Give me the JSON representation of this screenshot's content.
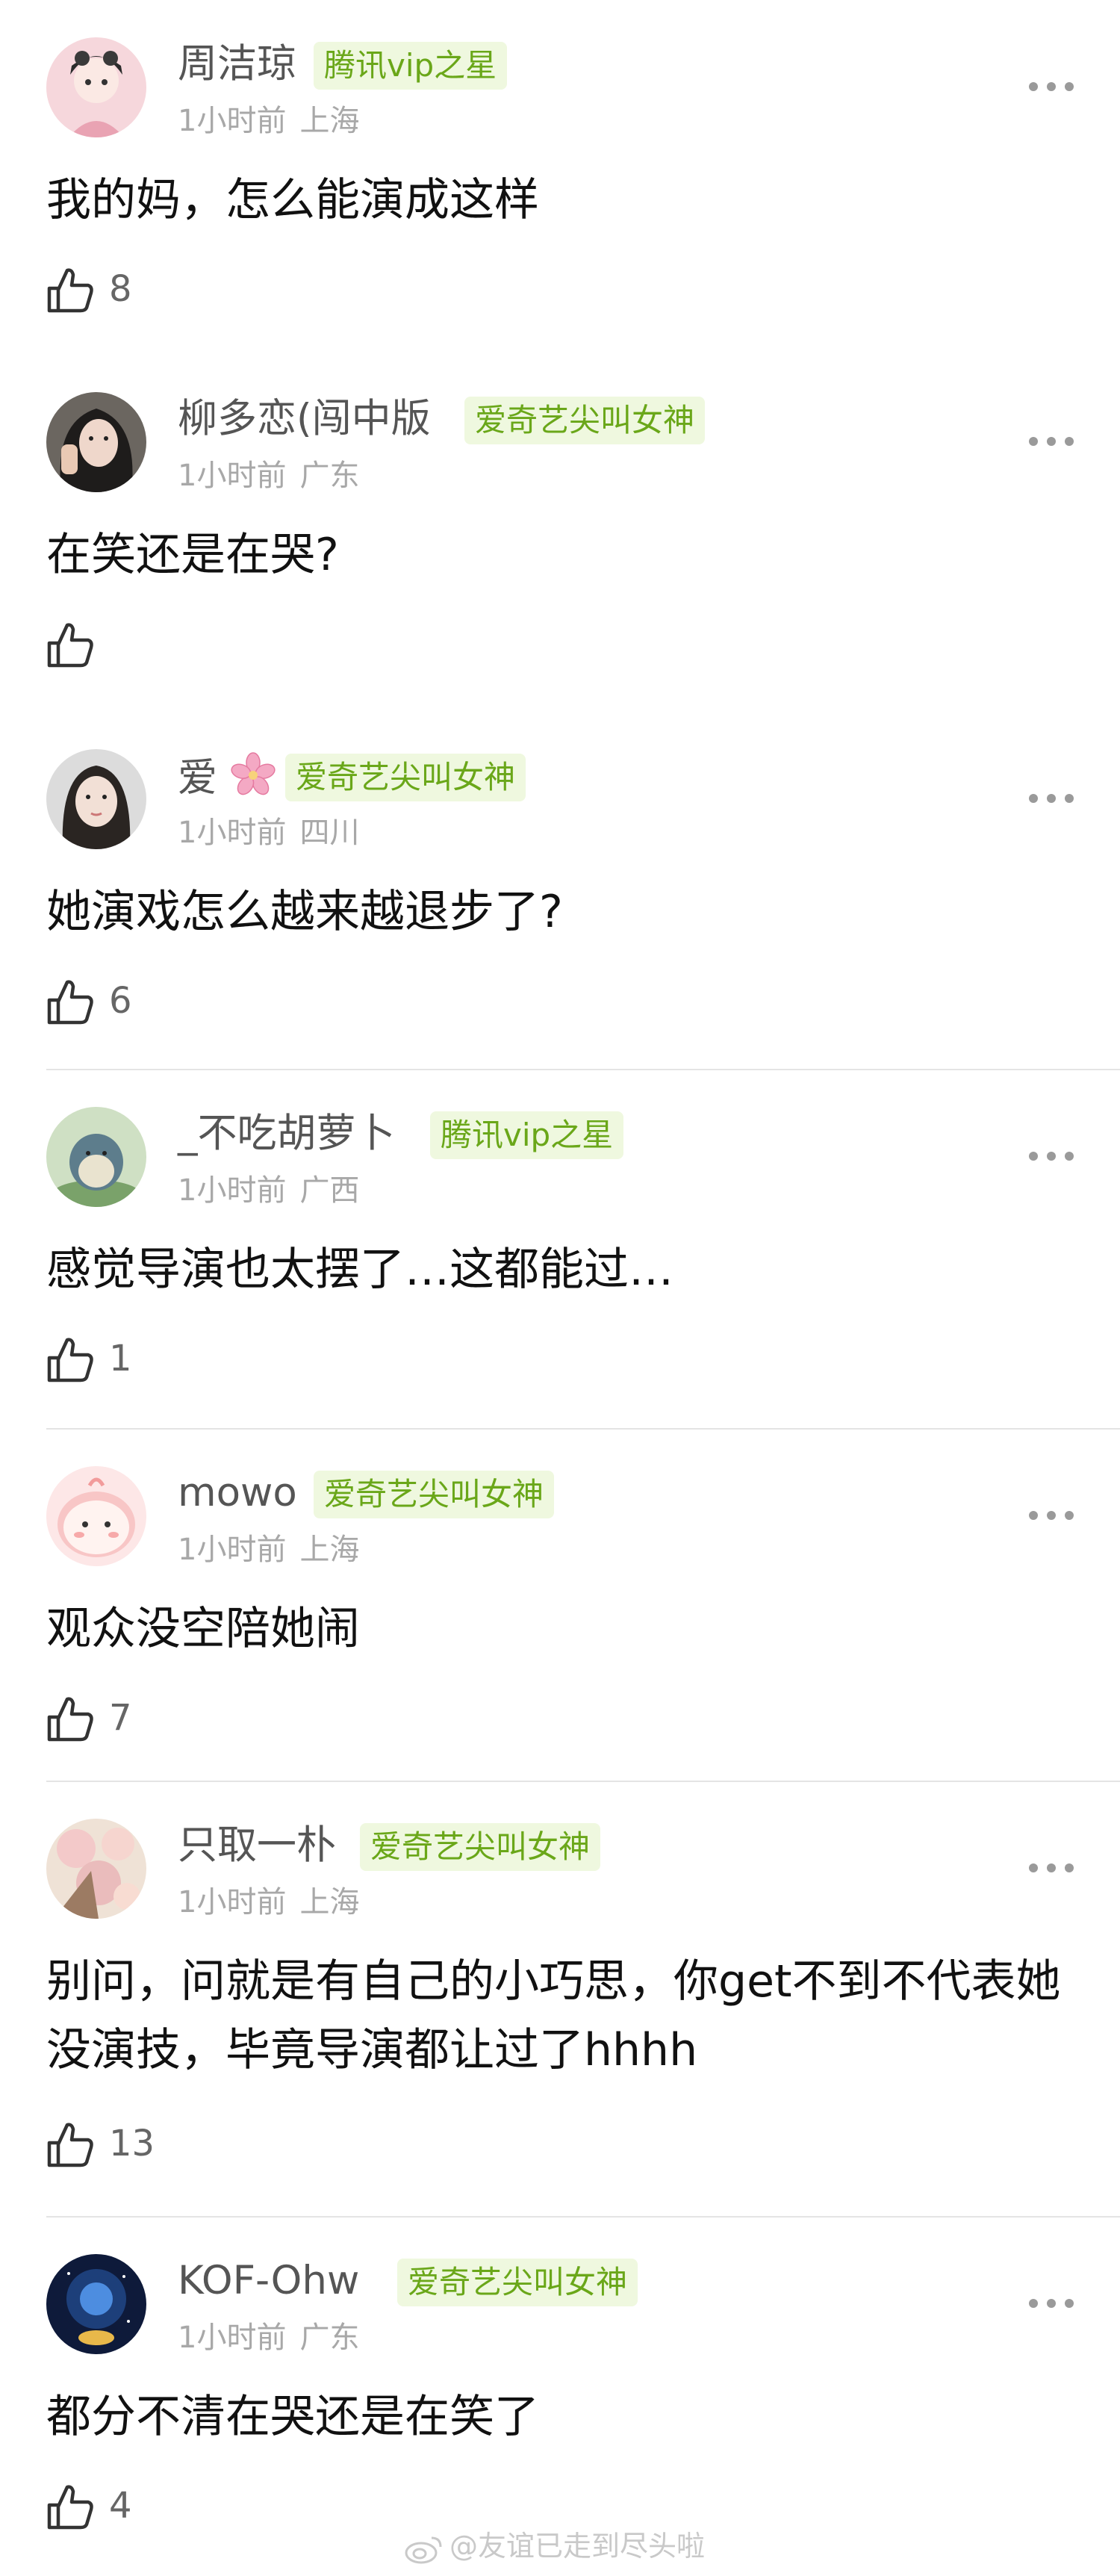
{
  "comments": [
    {
      "name": "周洁琼",
      "badge": "腾讯vip之星",
      "time": "1小时前",
      "location": "上海",
      "text": "我的妈，怎么能演成这样",
      "likes": "8"
    },
    {
      "name": "柳多恋(闯中版",
      "badge": "爱奇艺尖叫女神",
      "time": "1小时前",
      "location": "广东",
      "text": "在笑还是在哭?",
      "likes": ""
    },
    {
      "name": "爱",
      "badge": "爱奇艺尖叫女神",
      "time": "1小时前",
      "location": "四川",
      "text": "她演戏怎么越来越退步了?",
      "likes": "6"
    },
    {
      "name": "_不吃胡萝卜",
      "badge": "腾讯vip之星",
      "time": "1小时前",
      "location": "广西",
      "text": "感觉导演也太摆了…这都能过…",
      "likes": "1"
    },
    {
      "name": "mowo",
      "badge": "爱奇艺尖叫女神",
      "time": "1小时前",
      "location": "上海",
      "text": "观众没空陪她闹",
      "likes": "7"
    },
    {
      "name": "只取一朴",
      "badge": "爱奇艺尖叫女神",
      "time": "1小时前",
      "location": "上海",
      "text": "别问，问就是有自己的小巧思，你get不到不代表她没演技，毕竟导演都让过了hhhh",
      "likes": "13"
    },
    {
      "name": "KOF-Ohw",
      "badge": "爱奇艺尖叫女神",
      "time": "1小时前",
      "location": "广东",
      "text": "都分不清在哭还是在笑了",
      "likes": "4"
    }
  ],
  "watermark": "@友谊已走到尽头啦",
  "colors": {
    "badge_bg": "#eff8df",
    "badge_text": "#6aa719",
    "name": "#555555",
    "meta": "#a8a8a8"
  },
  "icons": {
    "like": "thumbs-up-icon",
    "more": "more-dots-icon",
    "flower": "cherry-blossom-icon",
    "watermark": "weibo-logo-icon"
  }
}
